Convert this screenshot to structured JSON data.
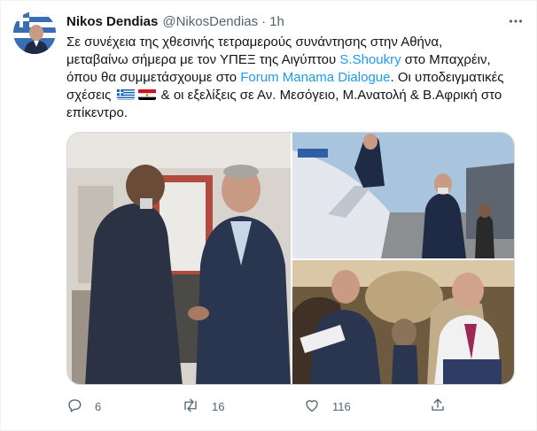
{
  "tweet": {
    "author_name": "Nikos Dendias",
    "author_handle": "@NikosDendias",
    "separator": "·",
    "time": "1h",
    "text": {
      "line1": "Σε συνέχεια της χθεσινής τετραμερούς συνάντησης στην Αθήνα,",
      "line2_a": "μεταβαίνω σήμερα με τον ΥΠΕΞ της Αιγύπτου ",
      "line2_mention": "S.Shoukry",
      "line2_b": " στο Μπαχρέιν,",
      "line3_a": "όπου θα συμμετάσχουμε στο ",
      "line3_mention": "Forum Manama Dialogue",
      "line3_b": ". Οι υποδειγματικές",
      "line4_a": "σχέσεις ",
      "line4_b": " & οι εξελίξεις σε Αν. Μεσόγειο, Μ.Ανατολή & Β.Αφρική στο",
      "line5": "επίκεντρο."
    },
    "flags": [
      "greece-flag",
      "egypt-flag"
    ]
  },
  "actions": {
    "replies": "6",
    "retweets": "16",
    "likes": "116"
  },
  "icons": {
    "avatar": "avatar",
    "more": "more-icon",
    "reply": "reply-icon",
    "retweet": "retweet-icon",
    "like": "heart-icon",
    "share": "share-icon"
  },
  "colors": {
    "link": "#1d9bf0",
    "secondary_text": "#536471",
    "primary_text": "#0f1419",
    "border": "#cfd9de"
  }
}
